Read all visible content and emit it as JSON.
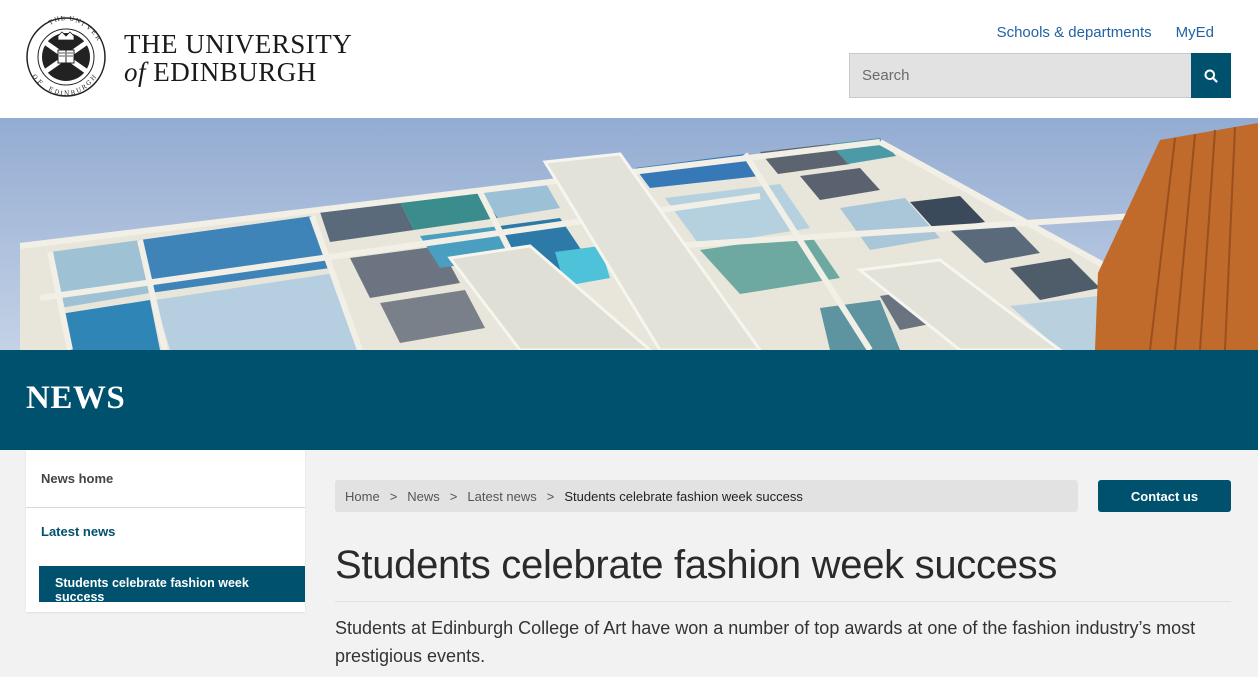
{
  "header": {
    "logo": {
      "line1": "THE UNIVERSITY",
      "of": "of",
      "line2": "EDINBURGH"
    },
    "top_links": [
      "Schools & departments",
      "MyEd"
    ],
    "search": {
      "placeholder": "Search"
    }
  },
  "band": {
    "title": "NEWS"
  },
  "sidebar": {
    "items": [
      {
        "label": "News home"
      },
      {
        "label": "Latest news"
      },
      {
        "label": "Students celebrate fashion week success"
      }
    ]
  },
  "breadcrumb": {
    "items": [
      "Home",
      "News",
      "Latest news"
    ],
    "current": "Students celebrate fashion week success",
    "separator": ">"
  },
  "contact_button": "Contact us",
  "article": {
    "title": "Students celebrate fashion week success",
    "intro": "Students at Edinburgh College of Art have won a number of top awards at one of the fashion industry’s most prestigious events."
  },
  "colors": {
    "brand": "#00516e",
    "link": "#2163a4",
    "breadcrumb_bg": "#e2e2e2"
  },
  "icons": {
    "search": "search-icon",
    "crest": "university-crest-icon"
  }
}
